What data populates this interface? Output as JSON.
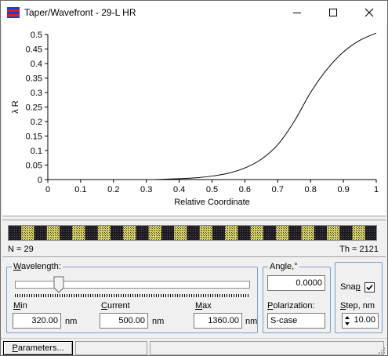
{
  "window": {
    "title": "Taper/Wavefront - 29-L HR",
    "buttons": {
      "minimize": "minimize",
      "maximize": "maximize",
      "close": "close"
    }
  },
  "chart_data": {
    "type": "line",
    "xlabel": "Relative Coordinate",
    "ylabel": "λ R",
    "xlim": [
      0,
      1
    ],
    "ylim": [
      0,
      0.5
    ],
    "xticks": [
      "0",
      "0.1",
      "0.2",
      "0.3",
      "0.4",
      "0.5",
      "0.6",
      "0.7",
      "0.8",
      "0.9",
      "1"
    ],
    "yticks": [
      "0",
      "0.05",
      "0.1",
      "0.15",
      "0.2",
      "0.25",
      "0.3",
      "0.35",
      "0.4",
      "0.45",
      "0.5"
    ],
    "series": [
      {
        "x": [
          0,
          0.1,
          0.2,
          0.3,
          0.35,
          0.4,
          0.45,
          0.5,
          0.55,
          0.6,
          0.65,
          0.7,
          0.75,
          0.8,
          0.85,
          0.9,
          0.95,
          1.0
        ],
        "y": [
          0,
          0,
          0,
          0,
          0.001,
          0.003,
          0.006,
          0.012,
          0.022,
          0.04,
          0.07,
          0.12,
          0.2,
          0.3,
          0.38,
          0.44,
          0.48,
          0.505
        ]
      }
    ],
    "grid": false
  },
  "strip": {
    "n_label": "N = 29",
    "th_label": "Th = 2121",
    "layers": 29
  },
  "wavelength": {
    "legend": "Wavelength:",
    "slider_value": 0.11,
    "min_label": "Min",
    "min_value": "320.00",
    "current_label": "Current",
    "current_value": "500.00",
    "max_label": "Max",
    "max_value": "1360.00",
    "unit": "nm"
  },
  "angle": {
    "legend": "Angle,°",
    "value": "0.0000",
    "polarization_label": "Polarization:",
    "polarization_value": "S-case"
  },
  "snap": {
    "label": "Snap",
    "checked": true,
    "step_label": "Step, nm",
    "step_value": "10.00"
  },
  "statusbar": {
    "parameters_button": "Parameters..."
  },
  "colors": {
    "accent": "#7aa0c8",
    "strip_dark": "#1c1c1c",
    "strip_light": "#d8d36a"
  }
}
